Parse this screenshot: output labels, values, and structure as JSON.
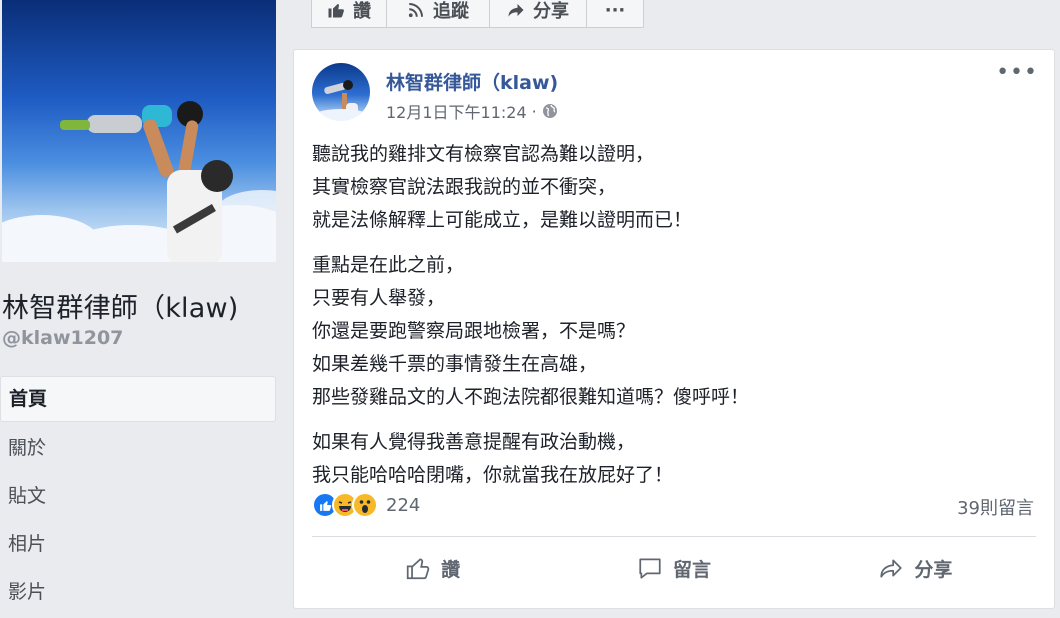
{
  "colors": {
    "link_blue": "#365899",
    "text_primary": "#1d2129",
    "text_secondary": "#606770",
    "page_bg": "#e9ebee",
    "like_blue": "#1877f2",
    "haha_yellow": "#f7b928"
  },
  "topbar": {
    "like_label": "讚",
    "follow_label": "追蹤",
    "share_label": "分享",
    "more_label": "···",
    "icons": [
      "thumbs-up-icon",
      "rss-icon",
      "share-arrow-icon",
      "ellipsis-icon"
    ]
  },
  "page": {
    "name": "林智群律師（klaw)",
    "handle": "@klaw1207"
  },
  "nav": {
    "items": [
      {
        "label": "首頁",
        "active": true
      },
      {
        "label": "關於",
        "active": false
      },
      {
        "label": "貼文",
        "active": false
      },
      {
        "label": "相片",
        "active": false
      },
      {
        "label": "影片",
        "active": false
      }
    ]
  },
  "post": {
    "author": "林智群律師（klaw)",
    "timestamp": "12月1日下午11:24",
    "separator": "·",
    "privacy_icon": "globe-icon",
    "more_label": "•••",
    "paragraphs": [
      [
        "聽說我的雞排文有檢察官認為難以證明，",
        "其實檢察官說法跟我說的並不衝突，",
        "就是法條解釋上可能成立，是難以證明而已！"
      ],
      [
        "重點是在此之前，",
        "只要有人舉發，",
        "你還是要跑警察局跟地檢署，不是嗎？",
        "如果差幾千票的事情發生在高雄，",
        "那些發雞品文的人不跑法院都很難知道嗎？傻呼呼！"
      ],
      [
        "如果有人覺得我善意提醒有政治動機，",
        "我只能哈哈哈閉嘴，你就當我在放屁好了！"
      ]
    ],
    "reactions": {
      "types": [
        "like",
        "haha",
        "wow"
      ],
      "count": "224"
    },
    "comments_count": "39則留言",
    "actions": {
      "like_label": "讚",
      "comment_label": "留言",
      "share_label": "分享"
    }
  }
}
